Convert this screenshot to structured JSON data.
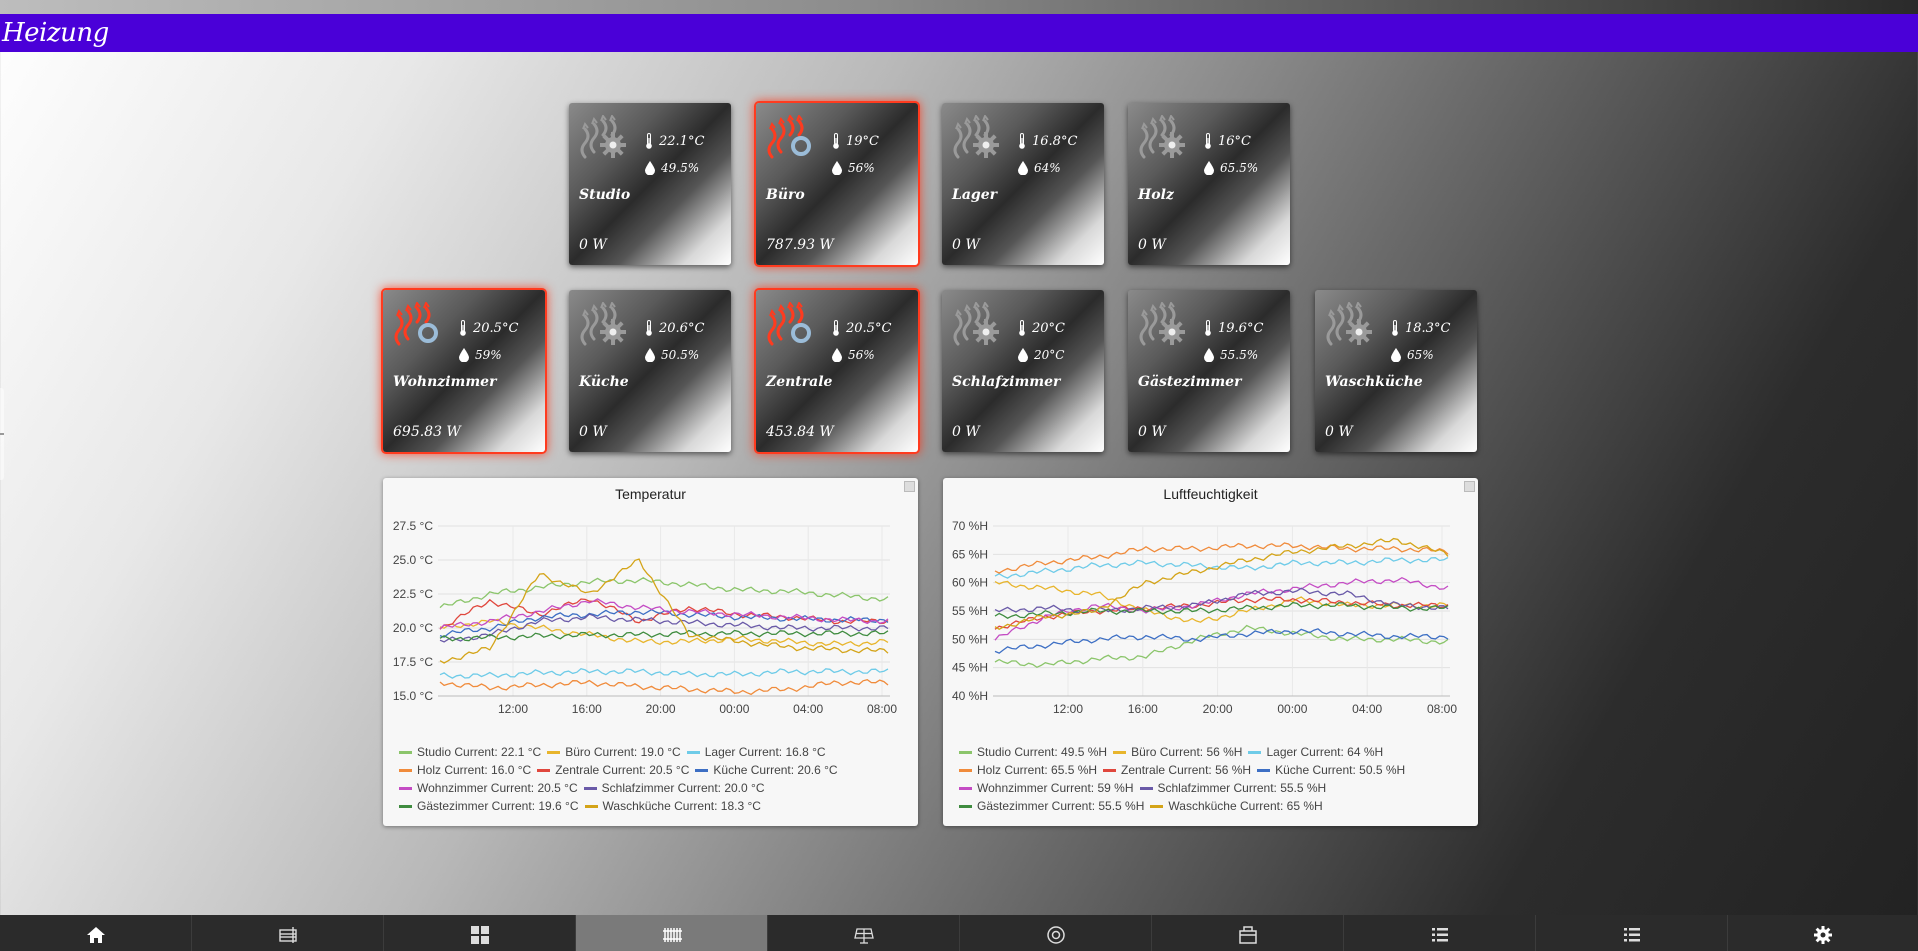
{
  "header": {
    "title": "Heizung"
  },
  "rooms": [
    {
      "name": "Studio",
      "temp": "22.1°C",
      "hum": "49.5%",
      "power": "0 W",
      "active": false
    },
    {
      "name": "Büro",
      "temp": "19°C",
      "hum": "56%",
      "power": "787.93 W",
      "active": true
    },
    {
      "name": "Lager",
      "temp": "16.8°C",
      "hum": "64%",
      "power": "0 W",
      "active": false
    },
    {
      "name": "Holz",
      "temp": "16°C",
      "hum": "65.5%",
      "power": "0 W",
      "active": false
    },
    {
      "name": "Wohnzimmer",
      "temp": "20.5°C",
      "hum": "59%",
      "power": "695.83 W",
      "active": true
    },
    {
      "name": "Küche",
      "temp": "20.6°C",
      "hum": "50.5%",
      "power": "0 W",
      "active": false
    },
    {
      "name": "Zentrale",
      "temp": "20.5°C",
      "hum": "56%",
      "power": "453.84 W",
      "active": true
    },
    {
      "name": "Schlafzimmer",
      "temp": "20°C",
      "hum": "20°C",
      "power": "0 W",
      "active": false
    },
    {
      "name": "Gästezimmer",
      "temp": "19.6°C",
      "hum": "55.5%",
      "power": "0 W",
      "active": false
    },
    {
      "name": "Waschküche",
      "temp": "18.3°C",
      "hum": "65%",
      "power": "0 W",
      "active": false
    }
  ],
  "colors": {
    "header": "#4a00d8",
    "active_glow": "#ff3b1f",
    "heat_active": "#ff3b1f",
    "heat_idle": "#9a9a9a"
  },
  "chart_data": [
    {
      "type": "line",
      "title": "Temperatur",
      "x_ticks": [
        "12:00",
        "16:00",
        "20:00",
        "00:00",
        "04:00",
        "08:00"
      ],
      "y_ticks": [
        "15.0 °C",
        "17.5 °C",
        "20.0 °C",
        "22.5 °C",
        "25.0 °C",
        "27.5 °C"
      ],
      "ylim": [
        15.0,
        27.5
      ],
      "legend": [
        {
          "label": "Studio  Current: 22.1 °C",
          "color": "#8bc56b"
        },
        {
          "label": "Büro  Current: 19.0 °C",
          "color": "#e8b52c"
        },
        {
          "label": "Lager  Current: 16.8 °C",
          "color": "#6ecbe8"
        },
        {
          "label": "Holz  Current: 16.0 °C",
          "color": "#f08b3b"
        },
        {
          "label": "Zentrale  Current: 20.5 °C",
          "color": "#e0473d"
        },
        {
          "label": "Küche  Current: 20.6 °C",
          "color": "#3d6fc4"
        },
        {
          "label": "Wohnzimmer  Current: 20.5 °C",
          "color": "#c44cc4"
        },
        {
          "label": "Schlafzimmer  Current: 20.0 °C",
          "color": "#6a5aa8"
        },
        {
          "label": "Gästezimmer  Current: 19.6 °C",
          "color": "#3f8c3f"
        },
        {
          "label": "Waschküche  Current: 18.3 °C",
          "color": "#d4a418"
        }
      ],
      "series": [
        {
          "values": [
            21.5,
            22.5,
            23.0,
            23.4,
            23.5,
            23.2,
            22.8,
            22.7,
            22.4,
            22.1
          ]
        },
        {
          "values": [
            20.0,
            20.5,
            20.0,
            19.5,
            19.0,
            19.0,
            19.2,
            19.0,
            18.8,
            19.0
          ]
        },
        {
          "values": [
            16.5,
            16.5,
            16.7,
            16.8,
            16.8,
            16.6,
            16.6,
            16.8,
            16.8,
            16.8
          ]
        },
        {
          "values": [
            16.0,
            15.6,
            15.8,
            16.0,
            15.7,
            15.5,
            15.3,
            15.5,
            16.0,
            16.0
          ]
        },
        {
          "values": [
            20.0,
            22.0,
            21.0,
            22.2,
            20.5,
            21.5,
            21.0,
            20.8,
            20.5,
            20.5
          ]
        },
        {
          "values": [
            19.5,
            20.0,
            20.8,
            21.0,
            21.2,
            21.0,
            20.8,
            20.7,
            20.6,
            20.6
          ]
        },
        {
          "values": [
            20.0,
            20.5,
            21.2,
            22.0,
            21.5,
            21.2,
            21.0,
            20.8,
            20.6,
            20.5
          ]
        },
        {
          "values": [
            19.0,
            19.5,
            20.5,
            20.8,
            20.6,
            20.4,
            20.2,
            20.0,
            20.0,
            20.0
          ]
        },
        {
          "values": [
            19.2,
            19.3,
            19.4,
            19.5,
            19.5,
            19.6,
            19.6,
            19.6,
            19.6,
            19.6
          ]
        },
        {
          "values": [
            17.5,
            18.5,
            24.0,
            22.5,
            25.0,
            19.5,
            19.0,
            18.6,
            18.4,
            18.3
          ]
        }
      ]
    },
    {
      "type": "line",
      "title": "Luftfeuchtigkeit",
      "x_ticks": [
        "12:00",
        "16:00",
        "20:00",
        "00:00",
        "04:00",
        "08:00"
      ],
      "y_ticks": [
        "40 %H",
        "45 %H",
        "50 %H",
        "55 %H",
        "60 %H",
        "65 %H",
        "70 %H"
      ],
      "ylim": [
        40,
        70
      ],
      "legend": [
        {
          "label": "Studio  Current: 49.5 %H",
          "color": "#8bc56b"
        },
        {
          "label": "Büro  Current: 56 %H",
          "color": "#e8b52c"
        },
        {
          "label": "Lager  Current: 64 %H",
          "color": "#6ecbe8"
        },
        {
          "label": "Holz  Current: 65.5 %H",
          "color": "#f08b3b"
        },
        {
          "label": "Zentrale  Current: 56 %H",
          "color": "#e0473d"
        },
        {
          "label": "Küche  Current: 50.5 %H",
          "color": "#3d6fc4"
        },
        {
          "label": "Wohnzimmer  Current: 59 %H",
          "color": "#c44cc4"
        },
        {
          "label": "Schlafzimmer  Current: 55.5 %H",
          "color": "#6a5aa8"
        },
        {
          "label": "Gästezimmer  Current: 55.5 %H",
          "color": "#3f8c3f"
        },
        {
          "label": "Waschküche  Current: 65 %H",
          "color": "#d4a418"
        }
      ],
      "series": [
        {
          "values": [
            46.0,
            45.5,
            46.5,
            47.0,
            50.0,
            52.0,
            51.0,
            50.0,
            50.0,
            49.5
          ]
        },
        {
          "values": [
            60.0,
            59.0,
            58.0,
            55.0,
            53.0,
            55.0,
            57.0,
            56.0,
            56.0,
            56.0
          ]
        },
        {
          "values": [
            61.0,
            62.0,
            63.0,
            63.5,
            63.0,
            62.5,
            63.5,
            63.5,
            64.0,
            64.0
          ]
        },
        {
          "values": [
            62.0,
            63.5,
            64.5,
            66.0,
            66.0,
            66.5,
            66.5,
            66.0,
            66.0,
            65.5
          ]
        },
        {
          "values": [
            52.0,
            54.0,
            55.0,
            55.5,
            56.0,
            57.0,
            57.0,
            56.5,
            56.0,
            56.0
          ]
        },
        {
          "values": [
            48.0,
            49.0,
            50.0,
            50.5,
            50.0,
            51.0,
            51.5,
            51.0,
            50.5,
            50.5
          ]
        },
        {
          "values": [
            50.0,
            54.0,
            56.0,
            55.0,
            56.0,
            58.0,
            59.0,
            60.0,
            60.5,
            59.0
          ]
        },
        {
          "values": [
            55.0,
            55.5,
            55.0,
            55.5,
            56.0,
            58.0,
            58.5,
            58.0,
            56.0,
            55.5
          ]
        },
        {
          "values": [
            54.0,
            54.5,
            55.0,
            55.0,
            55.0,
            55.5,
            56.0,
            56.0,
            55.5,
            55.5
          ]
        },
        {
          "values": [
            52.0,
            54.0,
            55.0,
            60.0,
            62.0,
            64.0,
            65.5,
            66.5,
            67.5,
            65.0
          ]
        }
      ]
    }
  ],
  "bottom_nav": [
    {
      "icon": "home-icon"
    },
    {
      "icon": "radiator-window-icon"
    },
    {
      "icon": "grid-icon"
    },
    {
      "icon": "radiator-icon",
      "active": true
    },
    {
      "icon": "solar-panel-icon"
    },
    {
      "icon": "camera-icon"
    },
    {
      "icon": "package-icon"
    },
    {
      "icon": "list-icon"
    },
    {
      "icon": "list-icon"
    },
    {
      "icon": "gear-icon"
    }
  ]
}
